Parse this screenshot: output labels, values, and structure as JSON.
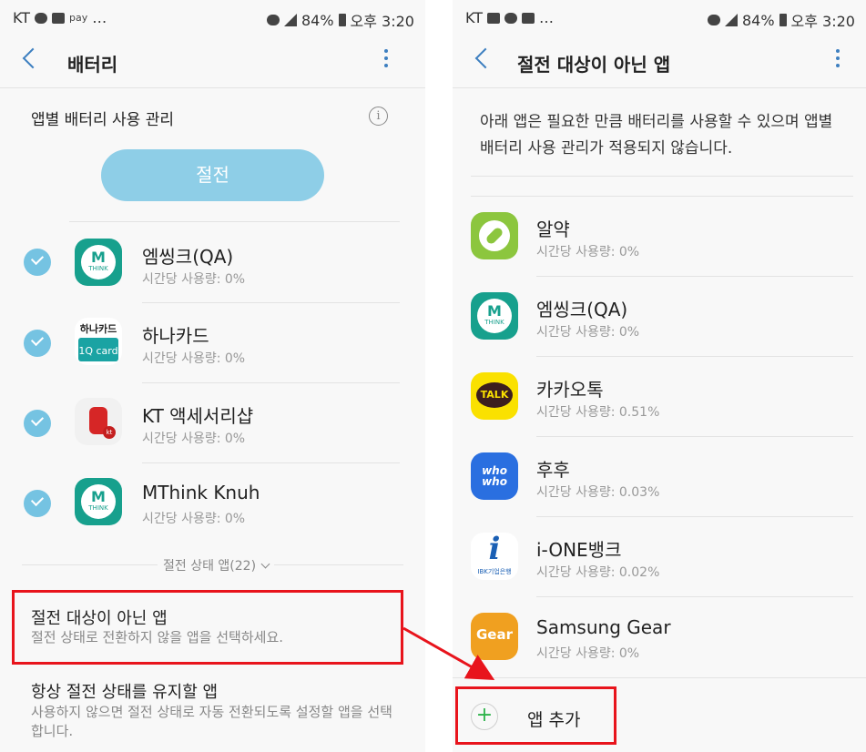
{
  "left": {
    "status": {
      "carrier": "KT",
      "pay_label": "pay",
      "battery": "84%",
      "time": "오후 3:20"
    },
    "appbar": {
      "title": "배터리"
    },
    "section_title": "앱별 배터리 사용 관리",
    "save_button": "절전",
    "apps": [
      {
        "name": "엠씽크(QA)",
        "usage": "시간당 사용량: 0%",
        "icon": "mthink-icon"
      },
      {
        "name": "하나카드",
        "usage": "시간당 사용량: 0%",
        "icon": "hanacard-icon"
      },
      {
        "name": "KT 액세서리샵",
        "usage": "시간당 사용량: 0%",
        "icon": "kt-accessory-icon"
      },
      {
        "name": "MThink Knuh",
        "usage": "시간당 사용량: 0%",
        "icon": "mthink-icon"
      }
    ],
    "icon_text": {
      "mthink_m": "M",
      "mthink_t": "THINK",
      "hana_top": "하나카드",
      "hana_card": "1Q card",
      "kt_badge": "kt"
    },
    "collapse_label": "절전 상태 앱(22)",
    "menu": [
      {
        "title": "절전 대상이 아닌 앱",
        "subtitle": "절전 상태로 전환하지 않을 앱을 선택하세요."
      },
      {
        "title": "항상 절전 상태를 유지할 앱",
        "subtitle": "사용하지 않으면 절전 상태로 자동 전환되도록 설정할 앱을 선택합니다."
      }
    ]
  },
  "right": {
    "status": {
      "carrier": "KT",
      "battery": "84%",
      "time": "오후 3:20"
    },
    "appbar": {
      "title": "절전 대상이 아닌 앱"
    },
    "description": "아래 앱은 필요한 만큼 배터리를 사용할 수 있으며 앱별 배터리 사용 관리가 적용되지 않습니다.",
    "apps": [
      {
        "name": "알약",
        "usage": "시간당 사용량: 0%",
        "icon": "alyac-icon"
      },
      {
        "name": "엠씽크(QA)",
        "usage": "시간당 사용량: 0%",
        "icon": "mthink-icon"
      },
      {
        "name": "카카오톡",
        "usage": "시간당 사용량: 0.51%",
        "icon": "kakaotalk-icon"
      },
      {
        "name": "후후",
        "usage": "시간당 사용량: 0.03%",
        "icon": "whowho-icon"
      },
      {
        "name": "i-ONE뱅크",
        "usage": "시간당 사용량: 0.02%",
        "icon": "ione-bank-icon"
      },
      {
        "name": "Samsung Gear",
        "usage": "시간당 사용량: 0%",
        "icon": "samsung-gear-icon"
      }
    ],
    "icon_text": {
      "kakao": "TALK",
      "whowho": "who who",
      "ione_l": "i",
      "ione_s": "IBK기업은행",
      "gear": "Gear",
      "mthink_m": "M",
      "mthink_t": "THINK"
    },
    "add_button": "앱 추가"
  },
  "annotation_color": "#e8141c"
}
